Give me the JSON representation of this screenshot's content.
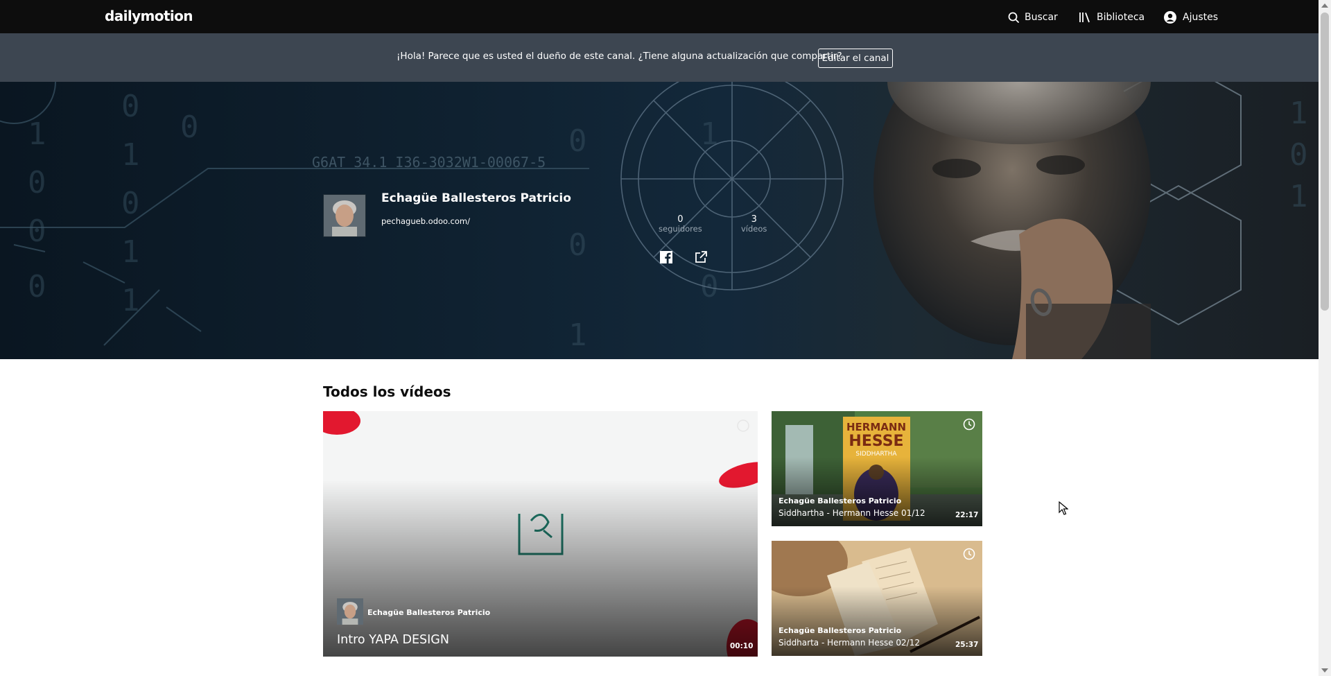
{
  "header": {
    "logo": "dailymotion",
    "nav": [
      {
        "label": "Buscar",
        "icon": "search-icon"
      },
      {
        "label": "Biblioteca",
        "icon": "library-icon"
      },
      {
        "label": "Ajustes",
        "icon": "user-circle-icon"
      }
    ]
  },
  "banner": {
    "message": "¡Hola! Parece que es usted el dueño de este canal. ¿Tiene alguna actualización que compartir?",
    "button_label": "Editar el canal"
  },
  "channel": {
    "name": "Echagüe Ballesteros Patricio",
    "url": "pechagueb.odoo.com/",
    "followers_count": "0",
    "followers_label": "seguidores",
    "videos_count": "3",
    "videos_label": "vídeos",
    "social": [
      "facebook-icon",
      "external-link-icon"
    ]
  },
  "videos_section": {
    "title": "Todos los vídeos",
    "items": [
      {
        "owner": "Echagüe Ballesteros Patricio",
        "title": "Intro YAPA DESIGN",
        "duration": "00:10"
      },
      {
        "owner": "Echagüe Ballesteros Patricio",
        "title": "Siddhartha - Hermann Hesse 01/12",
        "duration": "22:17"
      },
      {
        "owner": "Echagüe Ballesteros Patricio",
        "title": "Siddharta - Hermann Hesse 02/12",
        "duration": "25:37"
      }
    ],
    "thumb_text": {
      "book_author": "HERMANN HESSE",
      "book_title": "SIDDHARTHA"
    }
  },
  "colors": {
    "topbar": "#0d0d0d",
    "banner": "#3d4651",
    "hero": "#0f2130",
    "accent_red": "#e8001c"
  }
}
